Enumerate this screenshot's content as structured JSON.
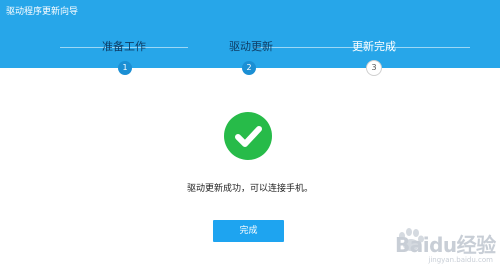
{
  "window": {
    "title": "驱动程序更新向导"
  },
  "colors": {
    "header": "#27a6e9",
    "success": "#27bb49",
    "button": "#1ea4f0"
  },
  "steps": [
    {
      "label": "准备工作",
      "number": "1",
      "state": "done"
    },
    {
      "label": "驱动更新",
      "number": "2",
      "state": "done"
    },
    {
      "label": "更新完成",
      "number": "3",
      "state": "current"
    }
  ],
  "result": {
    "icon": "check-circle-icon",
    "message": "驱动更新成功，可以连接手机。"
  },
  "actions": {
    "finish_label": "完成"
  },
  "watermark": {
    "text": "Baidu经验",
    "url": "jingyan.baidu.com"
  }
}
